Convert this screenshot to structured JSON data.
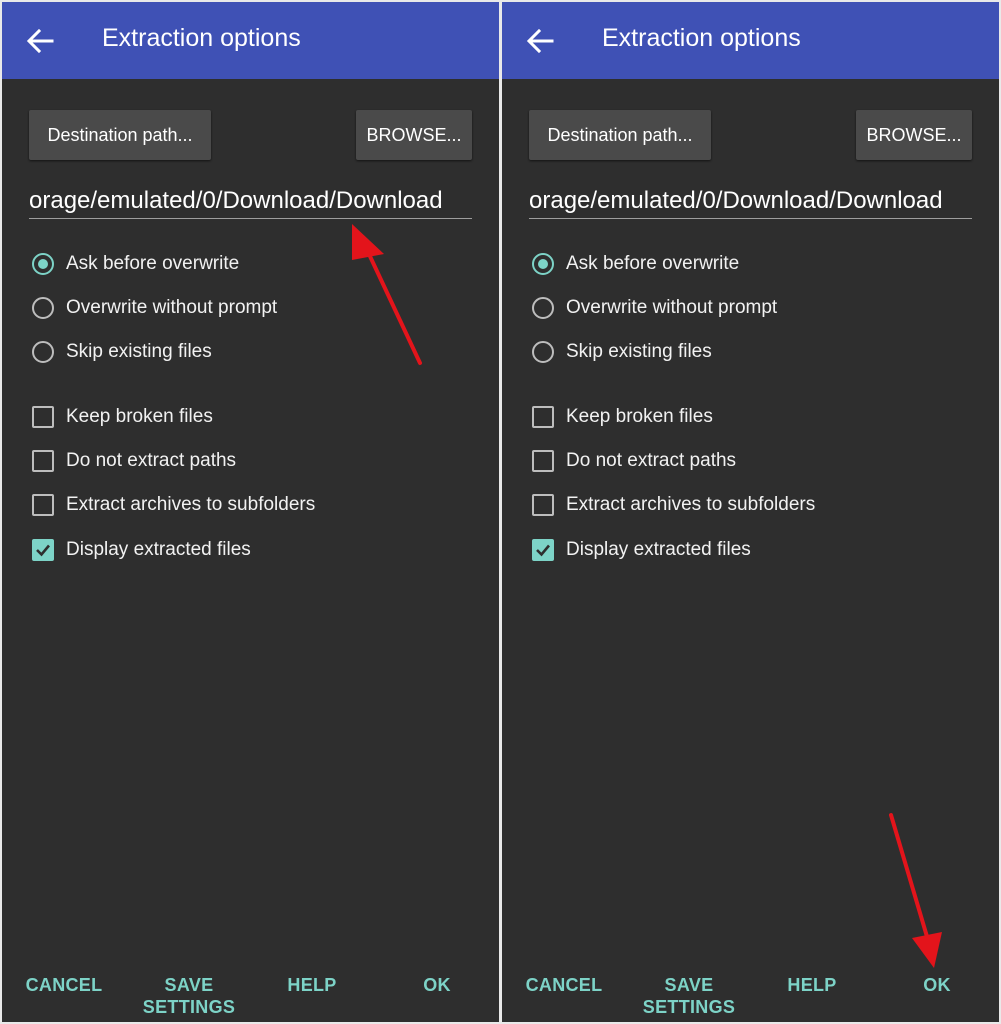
{
  "panels": [
    {
      "title": "Extraction options",
      "destination_button": "Destination path...",
      "browse_button": "BROWSE...",
      "path_value": "orage/emulated/0/Download/Download",
      "overwrite_options": [
        {
          "label": "Ask before overwrite",
          "selected": true
        },
        {
          "label": "Overwrite without prompt",
          "selected": false
        },
        {
          "label": "Skip existing files",
          "selected": false
        }
      ],
      "checkbox_options": [
        {
          "label": "Keep broken files",
          "checked": false
        },
        {
          "label": "Do not extract paths",
          "checked": false
        },
        {
          "label": "Extract archives to subfolders",
          "checked": false
        },
        {
          "label": "Display extracted files",
          "checked": true
        }
      ],
      "footer": {
        "cancel": "CANCEL",
        "save_line1": "SAVE",
        "save_line2": "SETTINGS",
        "help": "HELP",
        "ok": "OK"
      }
    },
    {
      "title": "Extraction options",
      "destination_button": "Destination path...",
      "browse_button": "BROWSE...",
      "path_value": "orage/emulated/0/Download/Download",
      "overwrite_options": [
        {
          "label": "Ask before overwrite",
          "selected": true
        },
        {
          "label": "Overwrite without prompt",
          "selected": false
        },
        {
          "label": "Skip existing files",
          "selected": false
        }
      ],
      "checkbox_options": [
        {
          "label": "Keep broken files",
          "checked": false
        },
        {
          "label": "Do not extract paths",
          "checked": false
        },
        {
          "label": "Extract archives to subfolders",
          "checked": false
        },
        {
          "label": "Display extracted files",
          "checked": true
        }
      ],
      "footer": {
        "cancel": "CANCEL",
        "save_line1": "SAVE",
        "save_line2": "SETTINGS",
        "help": "HELP",
        "ok": "OK"
      }
    }
  ],
  "colors": {
    "appbar": "#3f51b5",
    "background": "#2e2e2e",
    "accent": "#7dd3c7",
    "annotation_arrow": "#e3141b"
  },
  "annotations": [
    "red-arrow-pointing-to-path-field",
    "red-arrow-pointing-to-ok-button"
  ]
}
